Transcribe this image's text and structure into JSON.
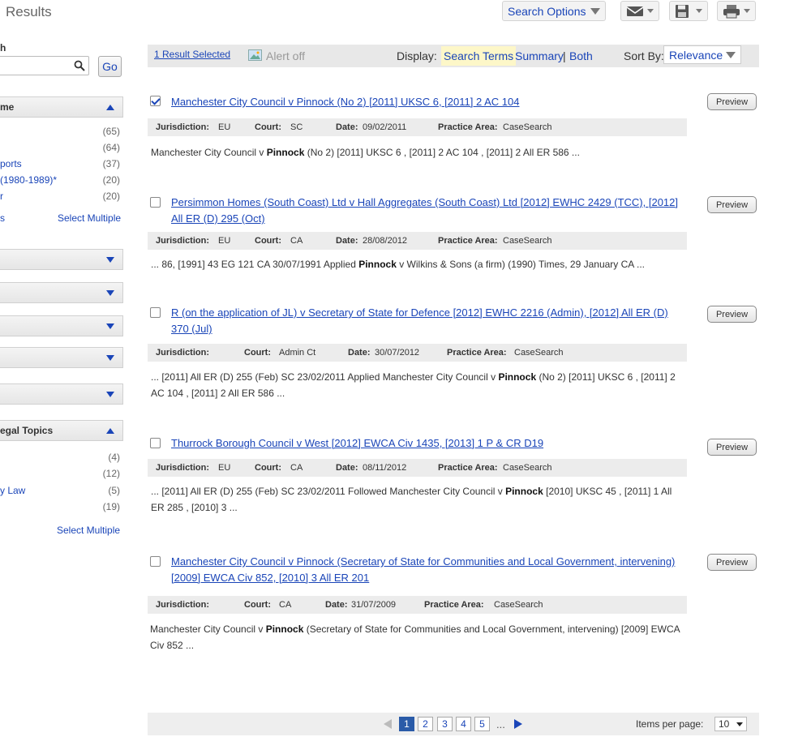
{
  "header": {
    "title": "Results",
    "search_options_label": "Search Options"
  },
  "sidebar": {
    "search_label": "h",
    "go_label": "Go",
    "facet1": {
      "title": "me",
      "items": [
        {
          "label": "",
          "count": "(65)"
        },
        {
          "label": "",
          "count": "(64)"
        },
        {
          "label": "ports",
          "count": "(37)"
        },
        {
          "label": "(1980-1989)*",
          "count": "(20)"
        },
        {
          "label": "r",
          "count": "(20)"
        }
      ],
      "more_label": "s",
      "select_multiple": "Select Multiple"
    },
    "facet2": {
      "title": "egal Topics",
      "items": [
        {
          "label": "",
          "count": "(4)"
        },
        {
          "label": "",
          "count": "(12)"
        },
        {
          "label": "y Law",
          "count": "(5)"
        },
        {
          "label": "",
          "count": "(19)"
        }
      ],
      "select_multiple": "Select Multiple"
    }
  },
  "toolbar": {
    "selected": "1 Result Selected",
    "alert": "Alert off",
    "display_label": "Display:",
    "display_search_terms": "Search Terms",
    "display_summary": "Summary",
    "display_sep": "|",
    "display_both": "Both",
    "sort_label": "Sort By:",
    "sort_value": "Relevance"
  },
  "meta_labels": {
    "jurisdiction": "Jurisdiction:",
    "court": "Court:",
    "date": "Date:",
    "practice_area": "Practice Area:"
  },
  "preview_label": "Preview",
  "results": [
    {
      "checked": true,
      "title": "Manchester City Council v Pinnock (No 2) [2011] UKSC 6, [2011] 2 AC 104",
      "jurisdiction": "EU",
      "court": "SC",
      "date": "09/02/2011",
      "practice_area": "CaseSearch",
      "snippet_pre": "Manchester City Council v ",
      "snippet_term": "Pinnock",
      "snippet_post": " (No 2) [2011] UKSC 6 , [2011] 2 AC 104 , [2011] 2 All ER 586 ..."
    },
    {
      "checked": false,
      "title": "Persimmon Homes (South Coast) Ltd v Hall Aggregates (South Coast) Ltd [2012] EWHC 2429 (TCC), [2012] All ER (D) 295 (Oct)",
      "jurisdiction": "EU",
      "court": "CA",
      "date": "28/08/2012",
      "practice_area": "CaseSearch",
      "snippet_pre": "...  86, [1991] 43 EG 121 CA 30/07/1991 Applied ",
      "snippet_term": "Pinnock",
      "snippet_post": " v Wilkins & Sons (a firm) (1990) Times, 29 January CA ..."
    },
    {
      "checked": false,
      "title": "R (on the application of JL) v Secretary of State for Defence [2012] EWHC 2216 (Admin), [2012] All ER (D) 370 (Jul)",
      "jurisdiction": "",
      "court": "Admin Ct",
      "date": "30/07/2012",
      "practice_area": "CaseSearch",
      "snippet_pre": "...  [2011] All ER (D) 255 (Feb) SC 23/02/2011 Applied Manchester City Council v ",
      "snippet_term": "Pinnock",
      "snippet_post": " (No 2) [2011] UKSC 6 , [2011] 2 AC 104 , [2011] 2 All ER 586 ..."
    },
    {
      "checked": false,
      "title": "Thurrock Borough Council v West [2012] EWCA Civ 1435, [2013] 1 P & CR D19",
      "jurisdiction": "EU",
      "court": "CA",
      "date": "08/11/2012",
      "practice_area": "CaseSearch",
      "snippet_pre": "...  [2011] All ER (D) 255 (Feb) SC 23/02/2011 Followed Manchester City Council v ",
      "snippet_term": "Pinnock",
      "snippet_post": " [2010] UKSC 45 , [2011] 1 All ER 285 , [2010] 3  ..."
    },
    {
      "checked": false,
      "title": "Manchester City Council v Pinnock (Secretary of State for Communities and Local Government, intervening) [2009] EWCA Civ 852, [2010] 3 All ER 201",
      "jurisdiction": "",
      "court": "CA",
      "date": "31/07/2009",
      "practice_area": "CaseSearch",
      "snippet_pre": "Manchester City Council v ",
      "snippet_term": "Pinnock",
      "snippet_post": " (Secretary of State for Communities and Local Government, intervening) [2009] EWCA Civ 852 ..."
    }
  ],
  "pagination": {
    "pages": [
      "1",
      "2",
      "3",
      "4",
      "5"
    ],
    "current": "1",
    "ellipsis": "...",
    "items_label": "Items per page:",
    "items_value": "10"
  }
}
